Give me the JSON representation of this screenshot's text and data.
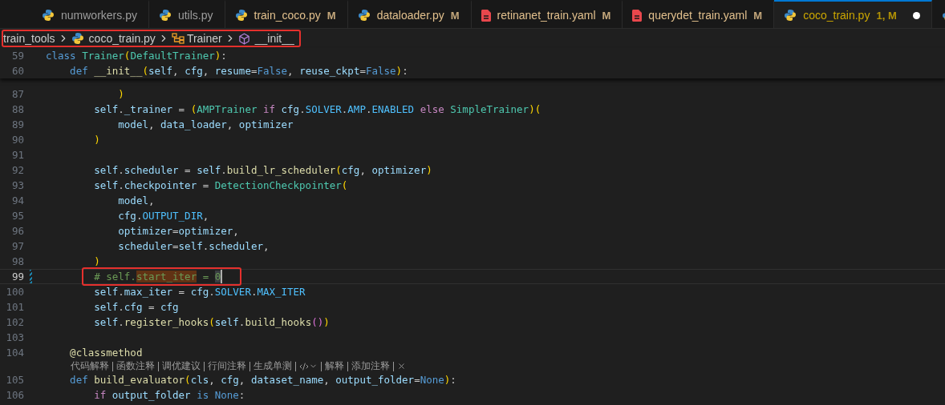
{
  "tabs": [
    {
      "kind": "python",
      "name": "numworkers.py",
      "modified": false,
      "problems": false,
      "selected": false,
      "dirty": false
    },
    {
      "kind": "python",
      "name": "utils.py",
      "modified": false,
      "problems": false,
      "selected": false,
      "dirty": false
    },
    {
      "kind": "python",
      "name": "train_coco.py",
      "status": "M",
      "modified": true,
      "problems": false,
      "selected": false,
      "dirty": false
    },
    {
      "kind": "python",
      "name": "dataloader.py",
      "status": "M",
      "modified": true,
      "problems": false,
      "selected": false,
      "dirty": false
    },
    {
      "kind": "yaml",
      "name": "retinanet_train.yaml",
      "status": "M",
      "modified": true,
      "problems": false,
      "selected": false,
      "dirty": false
    },
    {
      "kind": "yaml",
      "name": "querydet_train.yaml",
      "status": "M",
      "modified": true,
      "problems": false,
      "selected": false,
      "dirty": false
    },
    {
      "kind": "python",
      "name": "coco_train.py",
      "status": "1, M",
      "modified": true,
      "problems": true,
      "selected": true,
      "dirty": true
    },
    {
      "kind": "python",
      "selected": false
    }
  ],
  "breadcrumb": {
    "annotated": true,
    "items": [
      {
        "kind": "folder",
        "label": "train_tools"
      },
      {
        "kind": "python",
        "label": "coco_train.py"
      },
      {
        "kind": "class",
        "label": "Trainer"
      },
      {
        "kind": "method",
        "label": "__init__"
      }
    ]
  },
  "sticky_lines": [
    {
      "number": "59",
      "tokens": [
        {
          "text": "class",
          "kind": "kw"
        },
        {
          "text": " Trainer",
          "kind": "cls"
        },
        {
          "text": "(",
          "kind": "b1"
        },
        {
          "text": "DefaultTrainer",
          "kind": "cls"
        },
        {
          "text": ")",
          "kind": "b1"
        },
        {
          "text": ":",
          "kind": "p"
        }
      ]
    },
    {
      "number": "60",
      "tokens": [
        {
          "text": "    def",
          "kind": "kw"
        },
        {
          "text": " __init__",
          "kind": "fn"
        },
        {
          "text": "(",
          "kind": "b1"
        },
        {
          "text": "self",
          "kind": "v"
        },
        {
          "text": ", ",
          "kind": "p"
        },
        {
          "text": "cfg",
          "kind": "v"
        },
        {
          "text": ", ",
          "kind": "p"
        },
        {
          "text": "resume",
          "kind": "v"
        },
        {
          "text": "=",
          "kind": "p"
        },
        {
          "text": "False",
          "kind": "kw"
        },
        {
          "text": ", ",
          "kind": "p"
        },
        {
          "text": "reuse_ckpt",
          "kind": "v"
        },
        {
          "text": "=",
          "kind": "p"
        },
        {
          "text": "False",
          "kind": "kw"
        },
        {
          "text": ")",
          "kind": "b1"
        },
        {
          "text": ":",
          "kind": "p"
        }
      ]
    }
  ],
  "lines": [
    {
      "kind": "code",
      "number": "87",
      "tokens": [
        {
          "text": "            )",
          "kind": "b1"
        }
      ]
    },
    {
      "kind": "code",
      "number": "88",
      "tokens": [
        {
          "text": "        self",
          "kind": "v"
        },
        {
          "text": ".",
          "kind": "p"
        },
        {
          "text": "_trainer",
          "kind": "v"
        },
        {
          "text": " = ",
          "kind": "p"
        },
        {
          "text": "(",
          "kind": "b1"
        },
        {
          "text": "AMPTrainer",
          "kind": "cls"
        },
        {
          "text": " if",
          "kind": "c"
        },
        {
          "text": " cfg",
          "kind": "v"
        },
        {
          "text": ".",
          "kind": "p"
        },
        {
          "text": "SOLVER",
          "kind": "k2"
        },
        {
          "text": ".",
          "kind": "p"
        },
        {
          "text": "AMP",
          "kind": "k2"
        },
        {
          "text": ".",
          "kind": "p"
        },
        {
          "text": "ENABLED",
          "kind": "k2"
        },
        {
          "text": " else",
          "kind": "c"
        },
        {
          "text": " SimpleTrainer",
          "kind": "cls"
        },
        {
          "text": ")",
          "kind": "b1"
        },
        {
          "text": "(",
          "kind": "b1"
        }
      ]
    },
    {
      "kind": "code",
      "number": "89",
      "tokens": [
        {
          "text": "            model",
          "kind": "v"
        },
        {
          "text": ", ",
          "kind": "p"
        },
        {
          "text": "data_loader",
          "kind": "v"
        },
        {
          "text": ", ",
          "kind": "p"
        },
        {
          "text": "optimizer",
          "kind": "v"
        }
      ]
    },
    {
      "kind": "code",
      "number": "90",
      "tokens": [
        {
          "text": "        )",
          "kind": "b1"
        }
      ]
    },
    {
      "kind": "code",
      "number": "91"
    },
    {
      "kind": "code",
      "number": "92",
      "tokens": [
        {
          "text": "        self",
          "kind": "v"
        },
        {
          "text": ".",
          "kind": "p"
        },
        {
          "text": "scheduler",
          "kind": "v"
        },
        {
          "text": " = ",
          "kind": "p"
        },
        {
          "text": "self",
          "kind": "v"
        },
        {
          "text": ".",
          "kind": "p"
        },
        {
          "text": "build_lr_scheduler",
          "kind": "fn"
        },
        {
          "text": "(",
          "kind": "b1"
        },
        {
          "text": "cfg",
          "kind": "v"
        },
        {
          "text": ", ",
          "kind": "p"
        },
        {
          "text": "optimizer",
          "kind": "v"
        },
        {
          "text": ")",
          "kind": "b1"
        }
      ]
    },
    {
      "kind": "code",
      "number": "93",
      "tokens": [
        {
          "text": "        self",
          "kind": "v"
        },
        {
          "text": ".",
          "kind": "p"
        },
        {
          "text": "checkpointer",
          "kind": "v"
        },
        {
          "text": " = ",
          "kind": "p"
        },
        {
          "text": "DetectionCheckpointer",
          "kind": "cls"
        },
        {
          "text": "(",
          "kind": "b1"
        }
      ]
    },
    {
      "kind": "code",
      "number": "94",
      "tokens": [
        {
          "text": "            model",
          "kind": "v"
        },
        {
          "text": ",",
          "kind": "p"
        }
      ]
    },
    {
      "kind": "code",
      "number": "95",
      "tokens": [
        {
          "text": "            cfg",
          "kind": "v"
        },
        {
          "text": ".",
          "kind": "p"
        },
        {
          "text": "OUTPUT_DIR",
          "kind": "k2"
        },
        {
          "text": ",",
          "kind": "p"
        }
      ]
    },
    {
      "kind": "code",
      "number": "96",
      "tokens": [
        {
          "text": "            optimizer",
          "kind": "v"
        },
        {
          "text": "=",
          "kind": "p"
        },
        {
          "text": "optimizer",
          "kind": "v"
        },
        {
          "text": ",",
          "kind": "p"
        }
      ]
    },
    {
      "kind": "code",
      "number": "97",
      "tokens": [
        {
          "text": "            scheduler",
          "kind": "v"
        },
        {
          "text": "=",
          "kind": "p"
        },
        {
          "text": "self",
          "kind": "v"
        },
        {
          "text": ".",
          "kind": "p"
        },
        {
          "text": "scheduler",
          "kind": "v"
        },
        {
          "text": ",",
          "kind": "p"
        }
      ]
    },
    {
      "kind": "code",
      "number": "98",
      "tokens": [
        {
          "text": "        )",
          "kind": "b1"
        }
      ]
    },
    {
      "kind": "code",
      "number": "99",
      "current": true,
      "modified": true,
      "annotated": true,
      "cursor": true,
      "tokens": [
        {
          "text": "        # self.",
          "kind": "cm"
        },
        {
          "text": "start_iter",
          "kind": "cmh"
        },
        {
          "text": " = ",
          "kind": "cm"
        },
        {
          "text": "0",
          "kind": "cmsel"
        }
      ]
    },
    {
      "kind": "code",
      "number": "100",
      "tokens": [
        {
          "text": "        self",
          "kind": "v"
        },
        {
          "text": ".",
          "kind": "p"
        },
        {
          "text": "max_iter",
          "kind": "v"
        },
        {
          "text": " = ",
          "kind": "p"
        },
        {
          "text": "cfg",
          "kind": "v"
        },
        {
          "text": ".",
          "kind": "p"
        },
        {
          "text": "SOLVER",
          "kind": "k2"
        },
        {
          "text": ".",
          "kind": "p"
        },
        {
          "text": "MAX_ITER",
          "kind": "k2"
        }
      ]
    },
    {
      "kind": "code",
      "number": "101",
      "tokens": [
        {
          "text": "        self",
          "kind": "v"
        },
        {
          "text": ".",
          "kind": "p"
        },
        {
          "text": "cfg",
          "kind": "v"
        },
        {
          "text": " = ",
          "kind": "p"
        },
        {
          "text": "cfg",
          "kind": "v"
        }
      ]
    },
    {
      "kind": "code",
      "number": "102",
      "tokens": [
        {
          "text": "        self",
          "kind": "v"
        },
        {
          "text": ".",
          "kind": "p"
        },
        {
          "text": "register_hooks",
          "kind": "fn"
        },
        {
          "text": "(",
          "kind": "b1"
        },
        {
          "text": "self",
          "kind": "v"
        },
        {
          "text": ".",
          "kind": "p"
        },
        {
          "text": "build_hooks",
          "kind": "fn"
        },
        {
          "text": "()",
          "kind": "b2"
        },
        {
          "text": ")",
          "kind": "b1"
        }
      ]
    },
    {
      "kind": "code",
      "number": "103"
    },
    {
      "kind": "code",
      "number": "104",
      "tokens": [
        {
          "text": "    @classmethod",
          "kind": "fn"
        }
      ]
    },
    {
      "kind": "codelens",
      "items": [
        {
          "kind": "link",
          "label": "代码解释"
        },
        {
          "kind": "link",
          "label": "函数注释"
        },
        {
          "kind": "link",
          "label": "调优建议"
        },
        {
          "kind": "link",
          "label": "行间注释"
        },
        {
          "kind": "link",
          "label": "生成单测"
        },
        {
          "kind": "menu"
        },
        {
          "kind": "link",
          "label": "解释"
        },
        {
          "kind": "link",
          "label": "添加注释"
        },
        {
          "kind": "close"
        }
      ]
    },
    {
      "kind": "code",
      "number": "105",
      "tokens": [
        {
          "text": "    def",
          "kind": "kw"
        },
        {
          "text": " build_evaluator",
          "kind": "fn"
        },
        {
          "text": "(",
          "kind": "b1"
        },
        {
          "text": "cls",
          "kind": "v"
        },
        {
          "text": ", ",
          "kind": "p"
        },
        {
          "text": "cfg",
          "kind": "v"
        },
        {
          "text": ", ",
          "kind": "p"
        },
        {
          "text": "dataset_name",
          "kind": "v"
        },
        {
          "text": ", ",
          "kind": "p"
        },
        {
          "text": "output_folder",
          "kind": "v"
        },
        {
          "text": "=",
          "kind": "p"
        },
        {
          "text": "None",
          "kind": "kw"
        },
        {
          "text": ")",
          "kind": "b1"
        },
        {
          "text": ":",
          "kind": "p"
        }
      ]
    },
    {
      "kind": "code",
      "number": "106",
      "tokens": [
        {
          "text": "        if",
          "kind": "c"
        },
        {
          "text": " output_folder",
          "kind": "v"
        },
        {
          "text": " is",
          "kind": "kw"
        },
        {
          "text": " None",
          "kind": "kw"
        },
        {
          "text": ":",
          "kind": "p"
        }
      ]
    }
  ]
}
